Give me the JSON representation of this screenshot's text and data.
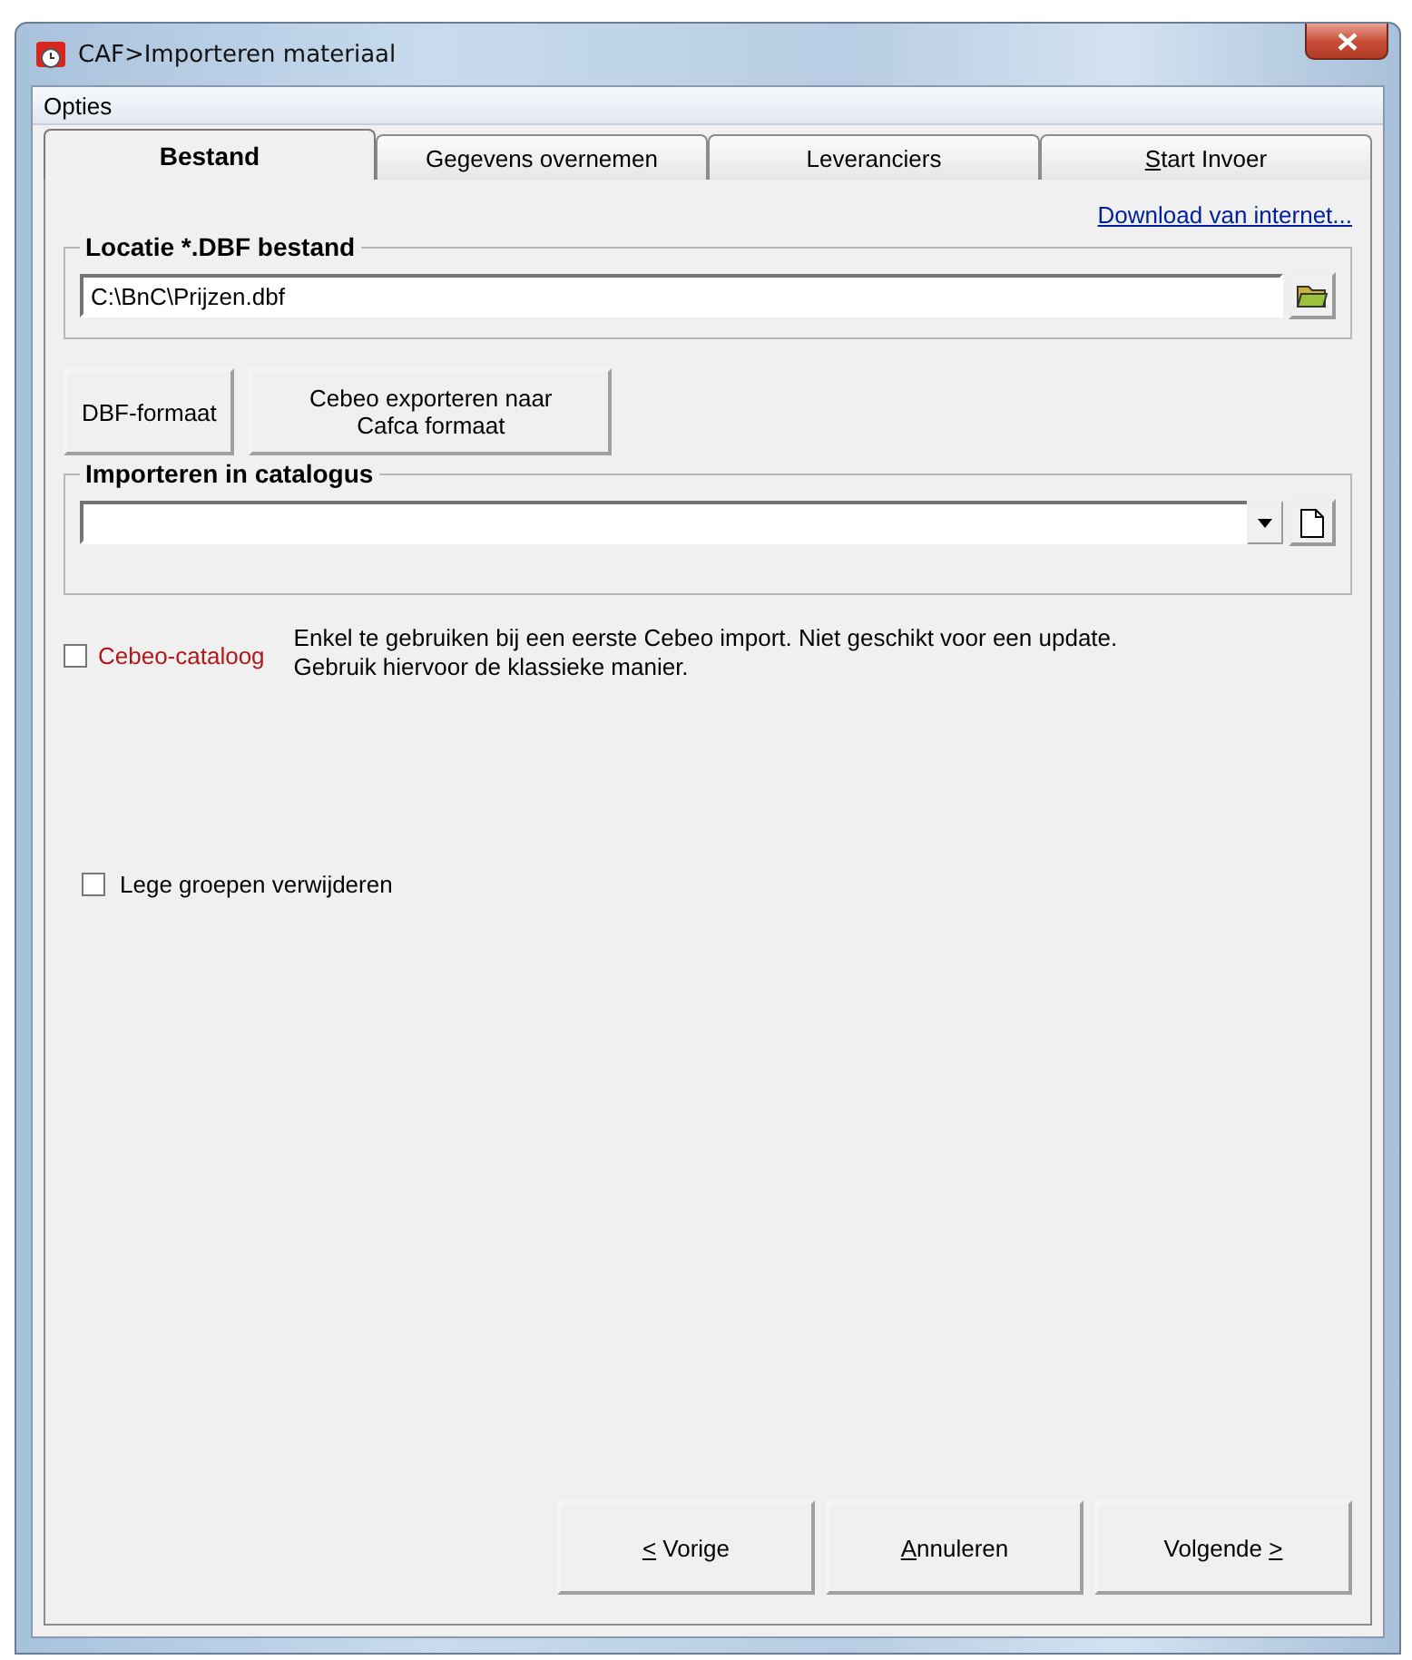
{
  "window": {
    "title": "CAF>Importeren materiaal"
  },
  "menu": [
    {
      "label": "Opties"
    }
  ],
  "tabs": [
    {
      "label": "Bestand",
      "selected": true,
      "underline_first": false
    },
    {
      "label": "Gegevens overnemen",
      "selected": false,
      "underline_first": false
    },
    {
      "label": "Leveranciers",
      "selected": false,
      "underline_first": false
    },
    {
      "label": "Start Invoer",
      "selected": false,
      "underline_first": true
    }
  ],
  "download_link": "Download van internet...",
  "location_group": {
    "title": "Locatie *.DBF bestand",
    "value": "C:\\BnC\\Prijzen.dbf"
  },
  "action_buttons": [
    {
      "label": "DBF-formaat"
    },
    {
      "label": "Cebeo exporteren naar Cafca formaat"
    }
  ],
  "catalog_group": {
    "title": "Importeren in catalogus"
  },
  "cebeo_option": {
    "label": "Cebeo-cataloog",
    "checked": false,
    "note": "Enkel te gebruiken bij een eerste Cebeo import.  Niet geschikt voor een update.  Gebruik hiervoor de klassieke manier."
  },
  "empty_groups_option": {
    "label": "Lege groepen verwijderen",
    "checked": false
  },
  "footer_buttons": [
    {
      "label": "< Vorige",
      "underline_first": true,
      "underline_last": false
    },
    {
      "label": "Annuleren",
      "underline_first": true,
      "underline_last": false
    },
    {
      "label": "Volgende >",
      "underline_first": false,
      "underline_last": true
    }
  ]
}
